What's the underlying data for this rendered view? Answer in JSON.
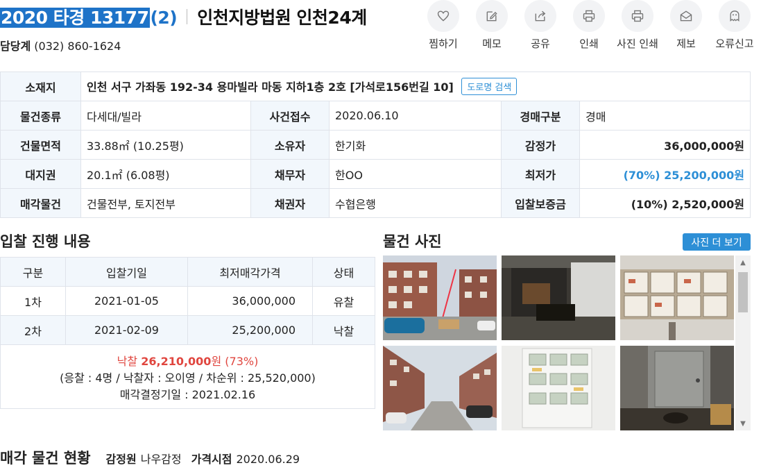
{
  "header": {
    "case_no_selected": "2020 타경 13177",
    "case_no_suffix": "(2)",
    "court": "인천지방법원 인천24계",
    "dept_label": "담당계",
    "dept_phone": "(032) 860-1624"
  },
  "actions": [
    {
      "label": "찜하기",
      "icon": "heart-icon"
    },
    {
      "label": "메모",
      "icon": "memo-edit-icon"
    },
    {
      "label": "공유",
      "icon": "share-icon"
    },
    {
      "label": "인쇄",
      "icon": "print-icon"
    },
    {
      "label": "사진 인쇄",
      "icon": "photo-print-icon"
    },
    {
      "label": "제보",
      "icon": "mail-icon"
    },
    {
      "label": "오류신고",
      "icon": "ghost-icon"
    }
  ],
  "info": {
    "address_label": "소재지",
    "address": "인천 서구 가좌동 192-34 용마빌라 마동 지하1층 2호 [가석로156번길 10]",
    "road_search": "도로명 검색",
    "rows": [
      [
        {
          "h": "물건종류"
        },
        {
          "v": "다세대/빌라"
        },
        {
          "h": "사건접수"
        },
        {
          "v": "2020.06.10"
        },
        {
          "h": "경매구분"
        },
        {
          "v": "경매"
        }
      ],
      [
        {
          "h": "건물면적"
        },
        {
          "v": "33.88㎡ (10.25평)"
        },
        {
          "h": "소유자"
        },
        {
          "v": "한기화"
        },
        {
          "h": "감정가"
        },
        {
          "v": "36,000,000원",
          "r": true
        }
      ],
      [
        {
          "h": "대지권"
        },
        {
          "v": "20.1㎡ (6.08평)"
        },
        {
          "h": "채무자"
        },
        {
          "v": "한OO"
        },
        {
          "h": "최저가"
        },
        {
          "v": "(70%) 25,200,000원",
          "r": true,
          "blue": true
        }
      ],
      [
        {
          "h": "매각물건"
        },
        {
          "v": "건물전부, 토지전부"
        },
        {
          "h": "채권자"
        },
        {
          "v": "수협은행"
        },
        {
          "h": "입찰보증금"
        },
        {
          "v": "(10%) 2,520,000원",
          "r": true
        }
      ]
    ]
  },
  "bids": {
    "title": "입찰 진행 내용",
    "columns": [
      "구분",
      "입찰기일",
      "최저매각가격",
      "상태"
    ],
    "rows": [
      {
        "round": "1차",
        "date": "2021-01-05",
        "price": "36,000,000",
        "status": "유찰"
      },
      {
        "round": "2차",
        "date": "2021-02-09",
        "price": "25,200,000",
        "status": "낙찰"
      }
    ],
    "summary": {
      "sold_label": "낙찰",
      "sold_amount": "26,210,000",
      "won": "원",
      "ratio": "(73%)",
      "detail": "(응찰 : 4명 / 낙찰자 : 오이영 / 차순위 : 25,520,000)",
      "decision": "매각결정기일 : 2021.02.16"
    }
  },
  "photos": {
    "title": "물건 사진",
    "more": "사진 더 보기"
  },
  "bottom": {
    "title": "매각 물건 현황",
    "appraiser_label": "감정원",
    "appraiser": "나우감정",
    "price_date_label": "가격시점",
    "price_date": "2020.06.29"
  },
  "colors": {
    "accent": "#2d8fd6",
    "title_blue": "#1e73c8",
    "sold_red": "#e0463f",
    "header_bg": "#f2f7fc"
  }
}
